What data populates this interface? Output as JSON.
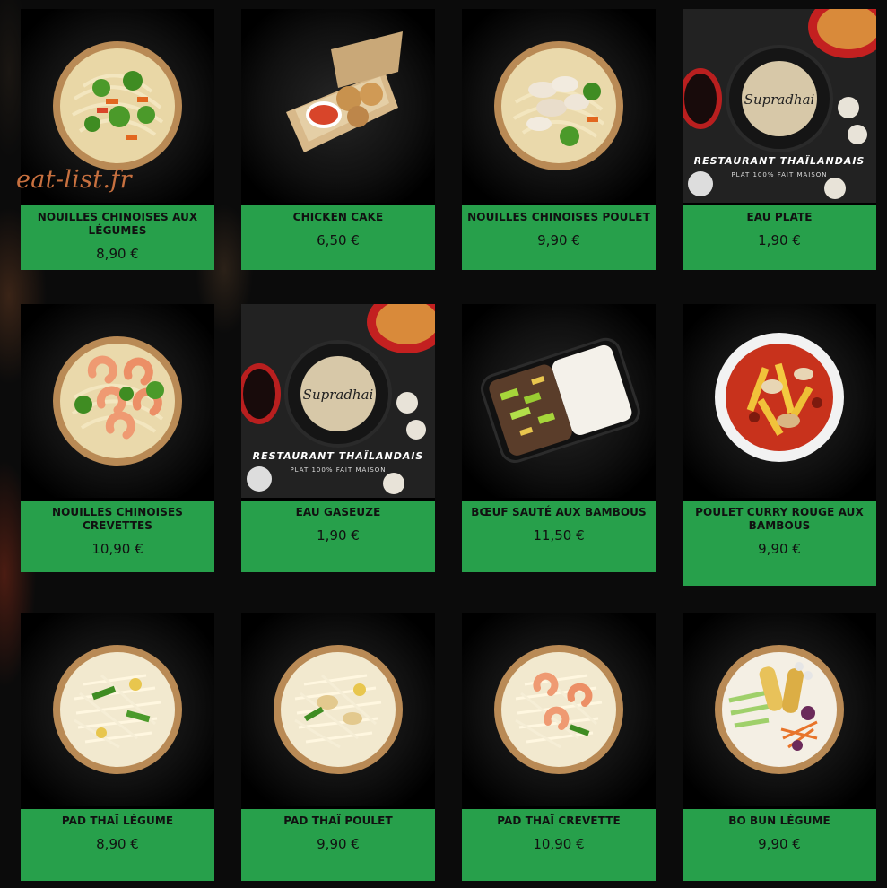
{
  "watermark": "eat-list.fr",
  "brand_banner": {
    "logo_text": "Supradhai",
    "title": "RESTAURANT THAÏLANDAIS",
    "subtitle": "PLAT 100% FAIT MAISON"
  },
  "colors": {
    "accent": "#27a04b",
    "background": "#0b0b0b",
    "watermark": "#c7703f"
  },
  "menu": [
    {
      "name": "NOUILLES CHINOISES AUX LÉGUMES",
      "price": "8,90 €",
      "image": "noodle-bowl-vegetables"
    },
    {
      "name": "CHICKEN CAKE",
      "price": "6,50 €",
      "image": "chicken-cake-box"
    },
    {
      "name": "NOUILLES CHINOISES POULET",
      "price": "9,90 €",
      "image": "noodle-bowl-chicken"
    },
    {
      "name": "EAU PLATE",
      "price": "1,90 €",
      "image": "restaurant-banner"
    },
    {
      "name": "NOUILLES CHINOISES CREVETTES",
      "price": "10,90 €",
      "image": "noodle-bowl-shrimp"
    },
    {
      "name": "EAU GASEUZE",
      "price": "1,90 €",
      "image": "restaurant-banner"
    },
    {
      "name": "BŒUF SAUTÉ AUX BAMBOUS",
      "price": "11,50 €",
      "image": "beef-rice-tray"
    },
    {
      "name": "POULET CURRY ROUGE AUX BAMBOUS",
      "price": "9,90 €",
      "image": "red-curry-bowl"
    },
    {
      "name": "PAD THAÏ LÉGUME",
      "price": "8,90 €",
      "image": "padthai-bowl"
    },
    {
      "name": "PAD THAÏ POULET",
      "price": "9,90 €",
      "image": "padthai-bowl"
    },
    {
      "name": "PAD THAÏ CREVETTE",
      "price": "10,90 €",
      "image": "padthai-bowl-shrimp"
    },
    {
      "name": "BO BUN LÉGUME",
      "price": "9,90 €",
      "image": "bobun-bowl"
    }
  ]
}
